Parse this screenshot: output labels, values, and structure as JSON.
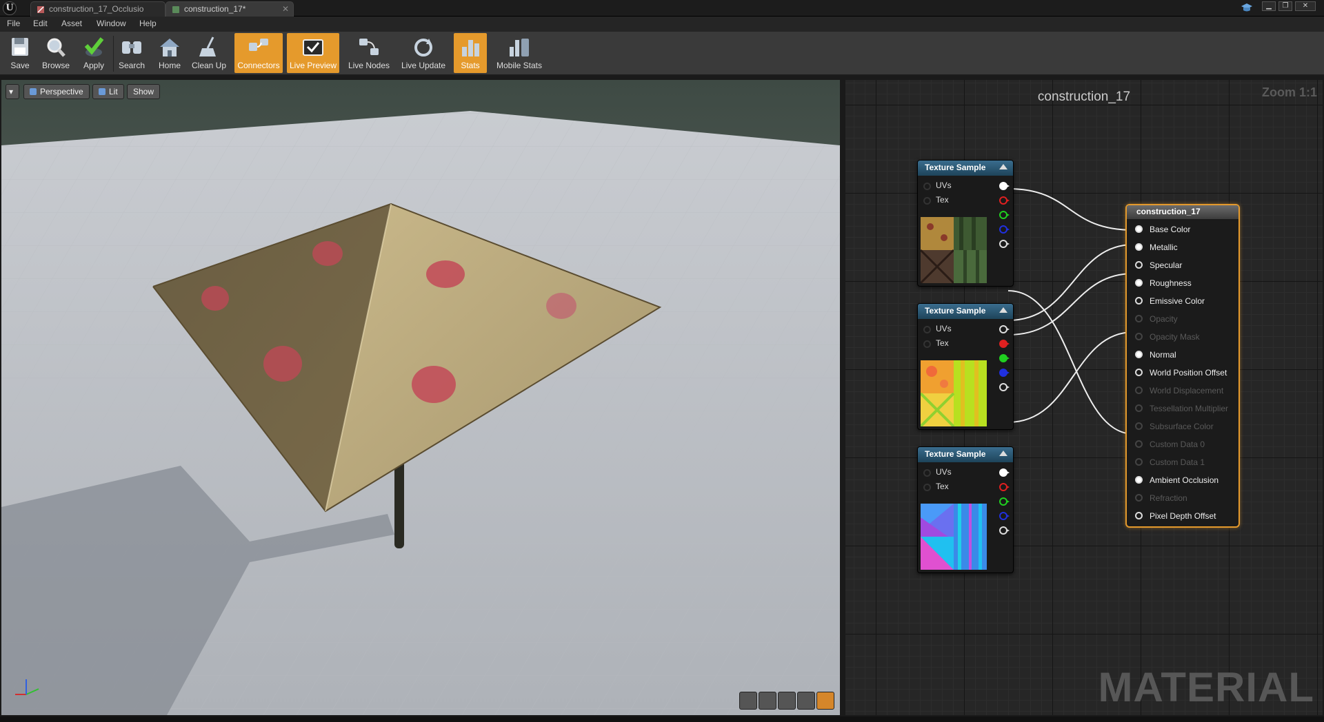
{
  "tabs": [
    {
      "label": "construction_17_Occlusio"
    },
    {
      "label": "construction_17*"
    }
  ],
  "menu": [
    "File",
    "Edit",
    "Asset",
    "Window",
    "Help"
  ],
  "toolbar": [
    {
      "label": "Save",
      "icon": "save-icon",
      "active": false
    },
    {
      "label": "Browse",
      "icon": "browse-icon",
      "active": false
    },
    {
      "label": "Apply",
      "icon": "apply-icon",
      "active": false
    },
    {
      "label": "Search",
      "icon": "search-icon",
      "active": false
    },
    {
      "label": "Home",
      "icon": "home-icon",
      "active": false
    },
    {
      "label": "Clean Up",
      "icon": "clean-up-icon",
      "active": false
    },
    {
      "label": "Connectors",
      "icon": "connectors-icon",
      "active": true
    },
    {
      "label": "Live Preview",
      "icon": "live-preview-icon",
      "active": true
    },
    {
      "label": "Live Nodes",
      "icon": "live-nodes-icon",
      "active": false
    },
    {
      "label": "Live Update",
      "icon": "live-update-icon",
      "active": false
    },
    {
      "label": "Stats",
      "icon": "stats-icon",
      "active": true
    },
    {
      "label": "Mobile Stats",
      "icon": "mobile-stats-icon",
      "active": false
    }
  ],
  "viewport": {
    "perspective_label": "Perspective",
    "lit_label": "Lit",
    "show_label": "Show"
  },
  "graph": {
    "title": "construction_17",
    "zoom": "Zoom 1:1",
    "watermark": "MATERIAL",
    "texture_nodes": [
      {
        "title": "Texture Sample",
        "uv_label": "UVs",
        "tex_label": "Tex",
        "thumbnail": "diffuse-texture"
      },
      {
        "title": "Texture Sample",
        "uv_label": "UVs",
        "tex_label": "Tex",
        "thumbnail": "mask-texture"
      },
      {
        "title": "Texture Sample",
        "uv_label": "UVs",
        "tex_label": "Tex",
        "thumbnail": "normal-texture"
      }
    ],
    "material_node": {
      "title": "construction_17",
      "inputs": [
        {
          "label": "Base Color",
          "enabled": true,
          "connected": true
        },
        {
          "label": "Metallic",
          "enabled": true,
          "connected": true
        },
        {
          "label": "Specular",
          "enabled": true,
          "connected": false
        },
        {
          "label": "Roughness",
          "enabled": true,
          "connected": true
        },
        {
          "label": "Emissive Color",
          "enabled": true,
          "connected": false
        },
        {
          "label": "Opacity",
          "enabled": false,
          "connected": false
        },
        {
          "label": "Opacity Mask",
          "enabled": false,
          "connected": false
        },
        {
          "label": "Normal",
          "enabled": true,
          "connected": true
        },
        {
          "label": "World Position Offset",
          "enabled": true,
          "connected": false
        },
        {
          "label": "World Displacement",
          "enabled": false,
          "connected": false
        },
        {
          "label": "Tessellation Multiplier",
          "enabled": false,
          "connected": false
        },
        {
          "label": "Subsurface Color",
          "enabled": false,
          "connected": false
        },
        {
          "label": "Custom Data 0",
          "enabled": false,
          "connected": false
        },
        {
          "label": "Custom Data 1",
          "enabled": false,
          "connected": false
        },
        {
          "label": "Ambient Occlusion",
          "enabled": true,
          "connected": true
        },
        {
          "label": "Refraction",
          "enabled": false,
          "connected": false
        },
        {
          "label": "Pixel Depth Offset",
          "enabled": true,
          "connected": false
        }
      ]
    }
  },
  "colors": {
    "accent": "#e59a2c",
    "node_header": "#2b5a78",
    "pin_red": "#e02020",
    "pin_green": "#20d020",
    "pin_blue": "#2030e0"
  }
}
